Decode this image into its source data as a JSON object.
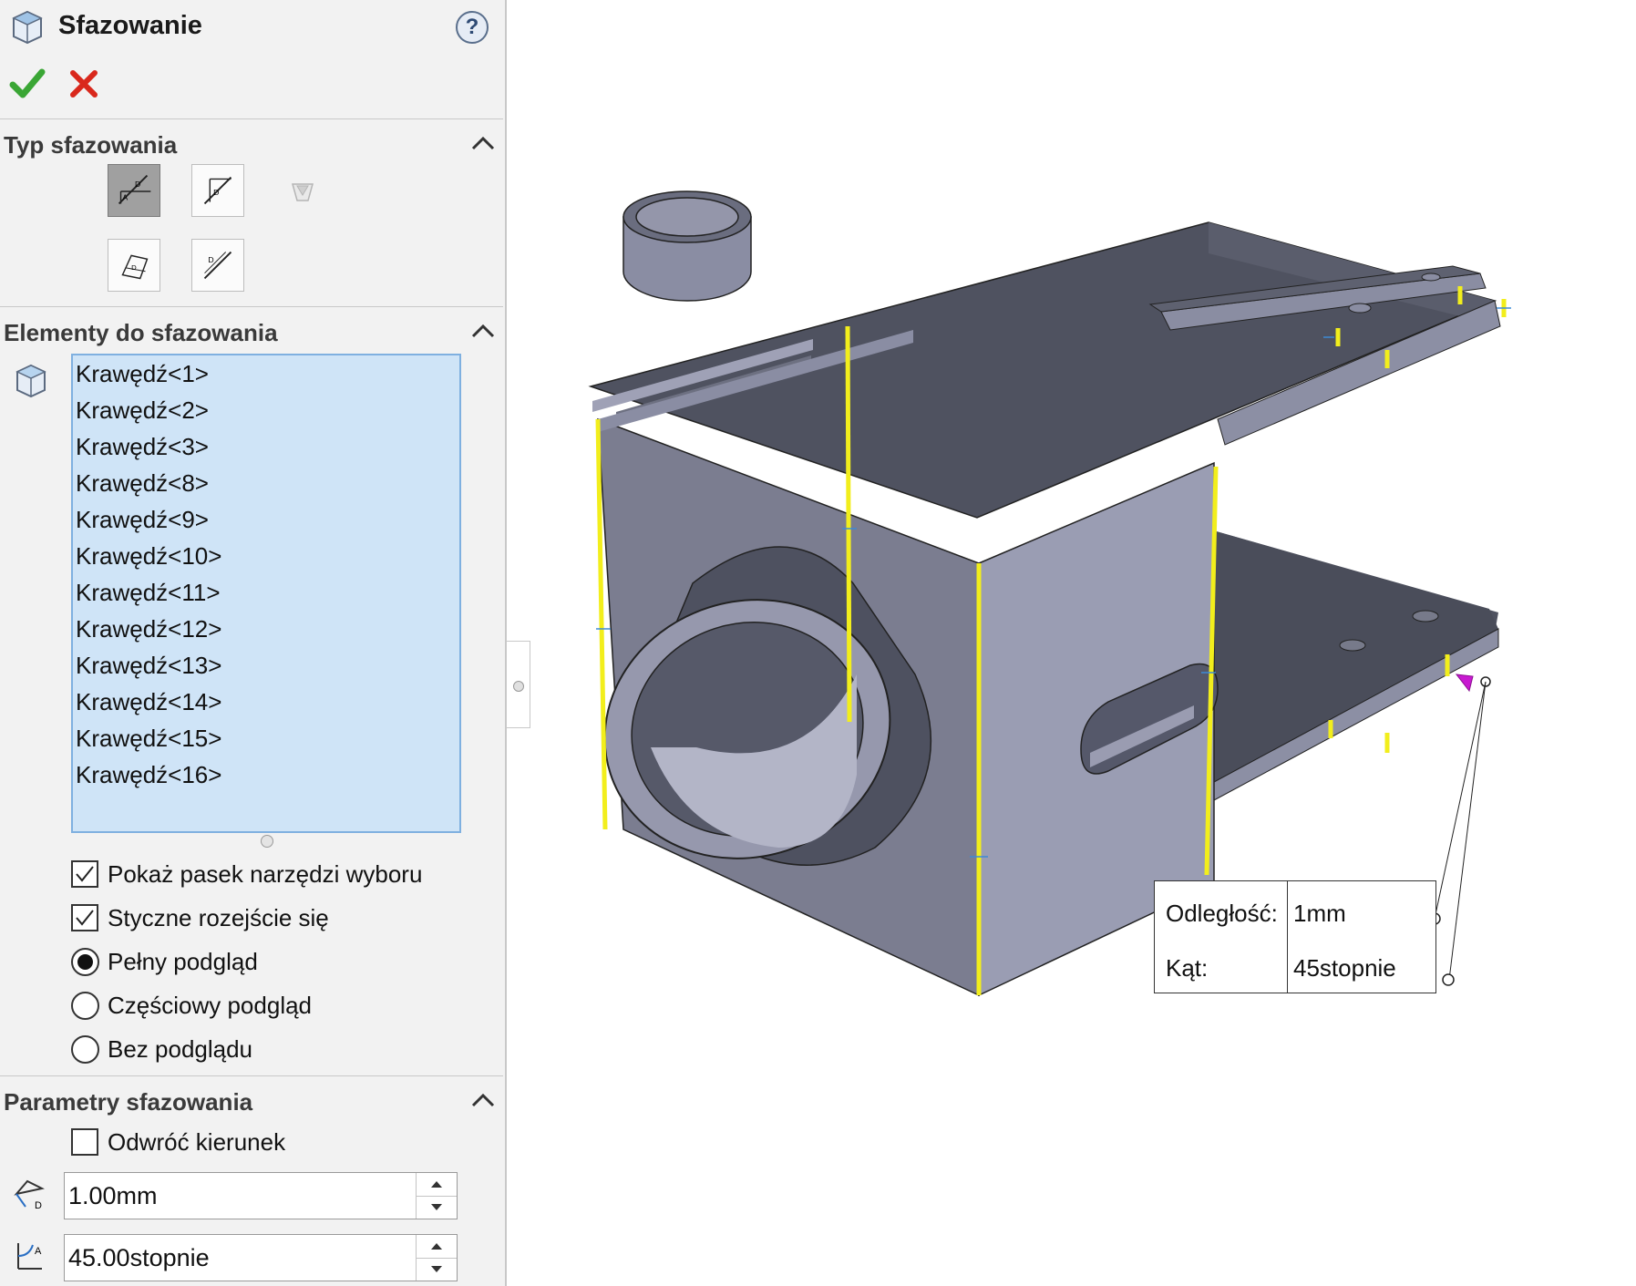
{
  "panel": {
    "title": "Sfazowanie",
    "help": "?",
    "sections": {
      "type": {
        "title": "Typ sfazowania"
      },
      "items": {
        "title": "Elementy do sfazowania",
        "list": [
          "Krawędź<1>",
          "Krawędź<2>",
          "Krawędź<3>",
          "Krawędź<8>",
          "Krawędź<9>",
          "Krawędź<10>",
          "Krawędź<11>",
          "Krawędź<12>",
          "Krawędź<13>",
          "Krawędź<14>",
          "Krawędź<15>",
          "Krawędź<16>"
        ]
      },
      "params": {
        "title": "Parametry sfazowania"
      }
    },
    "options": {
      "show_toolbar": {
        "label": "Pokaż pasek narzędzi wyboru",
        "checked": true
      },
      "tangent": {
        "label": "Styczne rozejście się",
        "checked": true
      },
      "full_preview": {
        "label": "Pełny podgląd",
        "selected": true
      },
      "partial_preview": {
        "label": "Częściowy podgląd",
        "selected": false
      },
      "no_preview": {
        "label": "Bez podglądu",
        "selected": false
      }
    },
    "parameters": {
      "reverse": {
        "label": "Odwróć kierunek",
        "checked": false
      },
      "distance": "1.00mm",
      "angle": "45.00stopnie"
    }
  },
  "callout": {
    "distance_label": "Odległość:",
    "distance_value": "1mm",
    "angle_label": "Kąt:",
    "angle_value": "45stopnie"
  },
  "colors": {
    "accept": "#3aa635",
    "cancel": "#d9281c",
    "selection_list": "#cfe4f7",
    "model_face_dark": "#4f5260",
    "model_face_front": "#7b7d90",
    "model_face_side": "#9a9db3",
    "edge_highlight": "#f2ee1c",
    "handle": "#c81ad1"
  },
  "icons": {
    "header": "chamfer-feature-icon",
    "ok": "checkmark-icon",
    "cancel": "close-icon",
    "collapse": "chevron-up-icon",
    "list": "edge-face-selection-icon",
    "distance": "distance-icon",
    "angle": "angle-icon"
  }
}
